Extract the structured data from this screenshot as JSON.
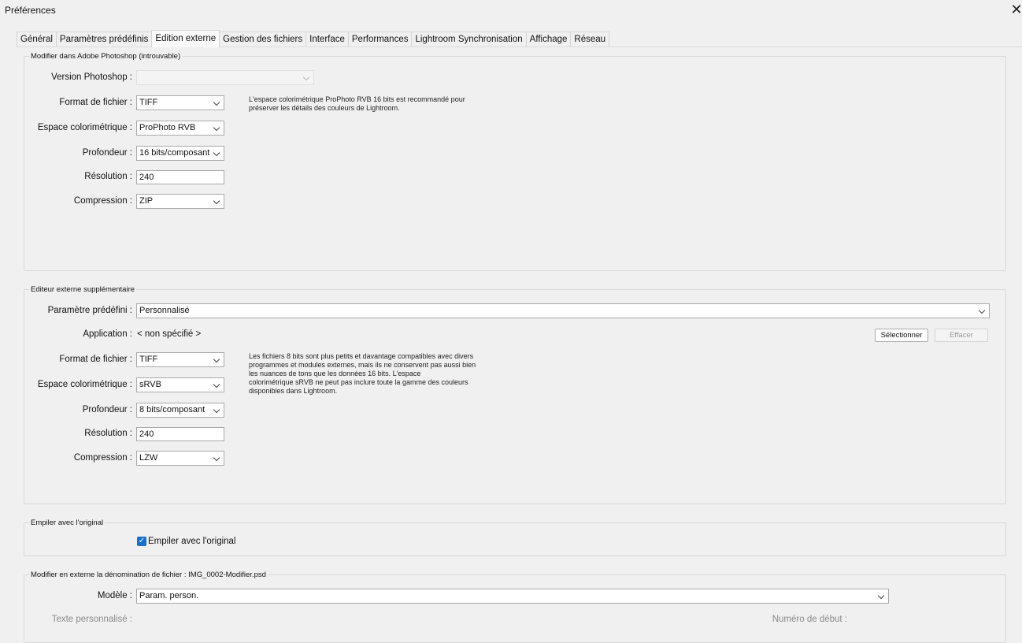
{
  "window": {
    "title": "Préférences",
    "close_icon": "close-icon"
  },
  "tabs": [
    {
      "label": "Général"
    },
    {
      "label": "Paramètres prédéfinis"
    },
    {
      "label": "Edition externe",
      "active": true
    },
    {
      "label": "Gestion des fichiers"
    },
    {
      "label": "Interface"
    },
    {
      "label": "Performances"
    },
    {
      "label": "Lightroom Synchronisation"
    },
    {
      "label": "Affichage"
    },
    {
      "label": "Réseau"
    }
  ],
  "photoshop": {
    "legend": "Modifier dans Adobe Photoshop (introuvable)",
    "version_label": "Version Photoshop :",
    "version_value": "",
    "format_label": "Format de fichier :",
    "format_value": "TIFF",
    "colorspace_label": "Espace colorimétrique :",
    "colorspace_value": "ProPhoto RVB",
    "depth_label": "Profondeur :",
    "depth_value": "16 bits/composant",
    "resolution_label": "Résolution :",
    "resolution_value": "240",
    "compression_label": "Compression :",
    "compression_value": "ZIP",
    "note_lines": [
      "L'espace colorimétrique ProPhoto RVB 16 bits est recommandé pour",
      "préserver les détails des couleurs de Lightroom."
    ]
  },
  "external": {
    "legend": "Editeur externe supplémentaire",
    "preset_label": "Paramètre prédéfini :",
    "preset_value": "Personnalisé",
    "application_label": "Application :",
    "application_value": "< non spécifié >",
    "select_button": "Sélectionner",
    "clear_button": "Effacer",
    "format_label": "Format de fichier :",
    "format_value": "TIFF",
    "colorspace_label": "Espace colorimétrique :",
    "colorspace_value": "sRVB",
    "depth_label": "Profondeur :",
    "depth_value": "8 bits/composant",
    "resolution_label": "Résolution :",
    "resolution_value": "240",
    "compression_label": "Compression :",
    "compression_value": "LZW",
    "note_lines": [
      "Les fichiers 8 bits sont plus petits et davantage compatibles avec divers",
      "programmes et modules externes, mais ils ne conservent pas aussi bien",
      "les nuances de tons que les données 16 bits. L'espace",
      "colorimétrique sRVB ne peut pas inclure toute la gamme des couleurs",
      "disponibles dans Lightroom."
    ]
  },
  "stack": {
    "legend": "Empiler avec l'original",
    "checkbox_label": "Empiler avec l'original",
    "checked": true
  },
  "naming": {
    "legend": "Modifier en externe la dénomination de fichier :  IMG_0002-Modifier.psd",
    "model_label": "Modèle :",
    "model_value": "Param. person.",
    "custom_text_label": "Texte personnalisé :",
    "start_number_label": "Numéro de début :"
  },
  "colors": {
    "accent": "#1a6fc7"
  }
}
